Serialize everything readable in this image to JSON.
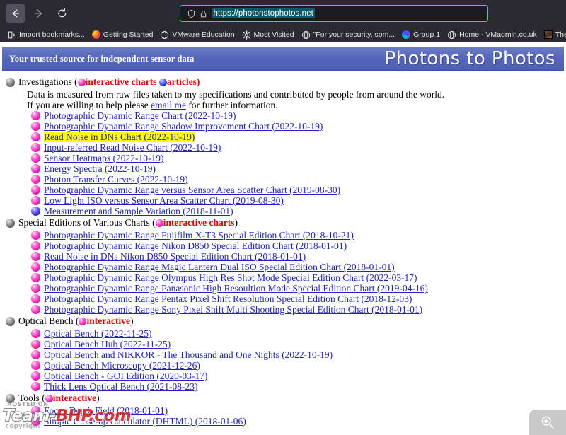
{
  "browser": {
    "nav": {
      "back_label": "Back",
      "forward_label": "Forward",
      "reload_label": "Reload"
    },
    "urlbar": {
      "url": "https://photonstophotos.net",
      "shield_icon": "shield-icon",
      "lock_icon": "lock-icon"
    },
    "bookmarks": [
      {
        "label": "Import bookmarks...",
        "icon": "import-icon"
      },
      {
        "label": "Getting Started",
        "icon": "firefox-icon"
      },
      {
        "label": "VMware Education",
        "icon": "globe-icon"
      },
      {
        "label": "Most Visited",
        "icon": "gear-icon"
      },
      {
        "label": "\"For your security, som...",
        "icon": "globe-icon"
      },
      {
        "label": "Group 1",
        "icon": "group-icon"
      },
      {
        "label": "Home - VMadmin.co.uk",
        "icon": "globe-icon"
      },
      {
        "label": "The server adm",
        "icon": "server-icon"
      }
    ]
  },
  "site": {
    "tagline": "Your trusted source for independent sensor data",
    "title": "Photons to Photos",
    "banner_color": "#5465bb"
  },
  "sections": [
    {
      "heading": "Investigations",
      "legend": [
        {
          "bullet": "pink",
          "text": "interactive charts"
        },
        {
          "bullet": "blue",
          "text": "articles"
        }
      ],
      "paragraphs": [
        "Data is measured from raw files taken to my specifications and contributed by people from around the world.",
        "If you are willing to help please email me for further information."
      ],
      "paragraph2_pre": "If you are willing to help please ",
      "paragraph2_link": "email me",
      "paragraph2_post": " for further information.",
      "links": [
        {
          "label": "Photographic Dynamic Range Chart (2022-10-19)",
          "bullet": "pink",
          "highlighted": false
        },
        {
          "label": "Photographic Dynamic Range Shadow Improvement Chart (2022-10-19)",
          "bullet": "pink",
          "highlighted": false
        },
        {
          "label": "Read Noise in DNs Chart (2022-10-19)",
          "bullet": "pink",
          "highlighted": true
        },
        {
          "label": "Input-referred Read Noise Chart (2022-10-19)",
          "bullet": "pink",
          "highlighted": false
        },
        {
          "label": "Sensor Heatmaps (2022-10-19)",
          "bullet": "pink",
          "highlighted": false
        },
        {
          "label": "Energy Spectra (2022-10-19)",
          "bullet": "pink",
          "highlighted": false
        },
        {
          "label": "Photon Transfer Curves (2022-10-19)",
          "bullet": "pink",
          "highlighted": false
        },
        {
          "label": "Photographic Dynamic Range versus Sensor Area Scatter Chart (2019-08-30)",
          "bullet": "pink",
          "highlighted": false
        },
        {
          "label": "Low Light ISO versus Sensor Area Scatter Chart (2019-08-30)",
          "bullet": "pink",
          "highlighted": false
        },
        {
          "label": "Measurement and Sample Variation (2018-11-01)",
          "bullet": "blue",
          "highlighted": false
        }
      ]
    },
    {
      "heading": "Special Editions of Various Charts",
      "legend": [
        {
          "bullet": "pink",
          "text": "interactive charts"
        }
      ],
      "links": [
        {
          "label": "Photographic Dynamic Range Fujifilm X-T3 Special Edition Chart (2018-10-21)",
          "bullet": "pink",
          "highlighted": false
        },
        {
          "label": "Photographic Dynamic Range Nikon D850 Special Edition Chart (2018-01-01)",
          "bullet": "pink",
          "highlighted": false
        },
        {
          "label": "Read Noise in DNs Nikon D850 Special Edition Chart (2018-01-01)",
          "bullet": "pink",
          "highlighted": false
        },
        {
          "label": "Photographic Dynamic Range Magic Lantern Dual ISO Special Edition Chart (2018-01-01)",
          "bullet": "pink",
          "highlighted": false
        },
        {
          "label": "Photographic Dynamic Range Olympus High Res Shot Mode Special Edition Chart (2022-03-17)",
          "bullet": "pink",
          "highlighted": false
        },
        {
          "label": "Photographic Dynamic Range Panasonic High Resoultion Mode Special Edition Chart (2019-04-16)",
          "bullet": "pink",
          "highlighted": false
        },
        {
          "label": "Photographic Dynamic Range Pentax Pixel Shift Resolution Special Edition Chart (2018-12-03)",
          "bullet": "pink",
          "highlighted": false
        },
        {
          "label": "Photographic Dynamic Range Sony Pixel Shift Multi Shooting Special Edition Chart (2018-01-01)",
          "bullet": "pink",
          "highlighted": false
        }
      ]
    },
    {
      "heading": "Optical Bench",
      "legend": [
        {
          "bullet": "pink",
          "text": "interactive"
        }
      ],
      "links": [
        {
          "label": "Optical Bench (2022-11-25)",
          "bullet": "pink",
          "highlighted": false
        },
        {
          "label": "Optical Bench Hub (2022-11-25)",
          "bullet": "pink",
          "highlighted": false
        },
        {
          "label": "Optical Bench and NIKKOR - The Thousand and One Nights (2022-10-19)",
          "bullet": "pink",
          "highlighted": false
        },
        {
          "label": "Optical Bench Microscopy (2021-12-26)",
          "bullet": "pink",
          "highlighted": false
        },
        {
          "label": "Optical Bench - GOI Edition (2020-03-17)",
          "bullet": "pink",
          "highlighted": false
        },
        {
          "label": "Thick Lens Optical Bench (2021-08-23)",
          "bullet": "pink",
          "highlighted": false
        }
      ]
    },
    {
      "heading": "Tools",
      "legend": [
        {
          "bullet": "pink",
          "text": "interactive"
        }
      ],
      "links": [
        {
          "label": "Focus Depth Field (2018-01-01)",
          "bullet": "pink",
          "highlighted": false
        },
        {
          "label": "Simple Close-up Calculator (DHTML) (2018-01-06)",
          "bullet": "pink",
          "highlighted": false
        }
      ]
    }
  ],
  "watermark": {
    "hosted": "HOSTED ON",
    "team": "Team-",
    "bhp": "BHP.com",
    "copyright": "copyright"
  },
  "zoom_fab": {
    "icon": "zoom-in-icon",
    "label": "Zoom in"
  }
}
